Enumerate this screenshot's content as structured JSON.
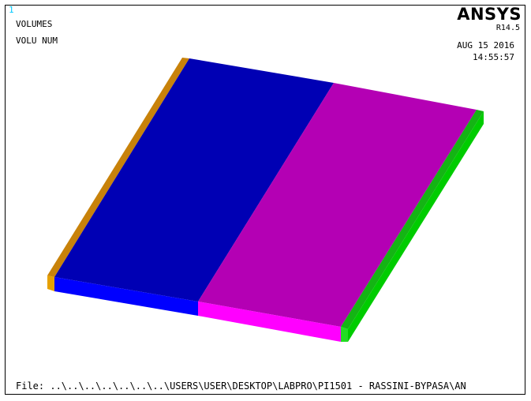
{
  "window": {
    "number": "1"
  },
  "header": {
    "title": "VOLUMES",
    "subtitle": "VOLU NUM",
    "logo": "ANSYS",
    "release": "R14.5",
    "date": "AUG 15 2016",
    "time": "14:55:57"
  },
  "footer": {
    "file_path": "File: ..\\..\\..\\..\\..\\..\\..\\USERS\\USER\\DESKTOP\\LABPRO\\PI1501 - RASSINI-BYPASA\\AN"
  },
  "model": {
    "volume_colors": {
      "left_edge_volume": "#c8820a",
      "blue_volume": "#0000b4",
      "magenta_volume": "#b400b4",
      "right_edge_volume": "#14b414"
    },
    "face_colors": {
      "blue_front": "#0000ff",
      "magenta_front": "#ff00ff",
      "green_right": "#00cc00",
      "orange_front": "#e6a000"
    }
  }
}
